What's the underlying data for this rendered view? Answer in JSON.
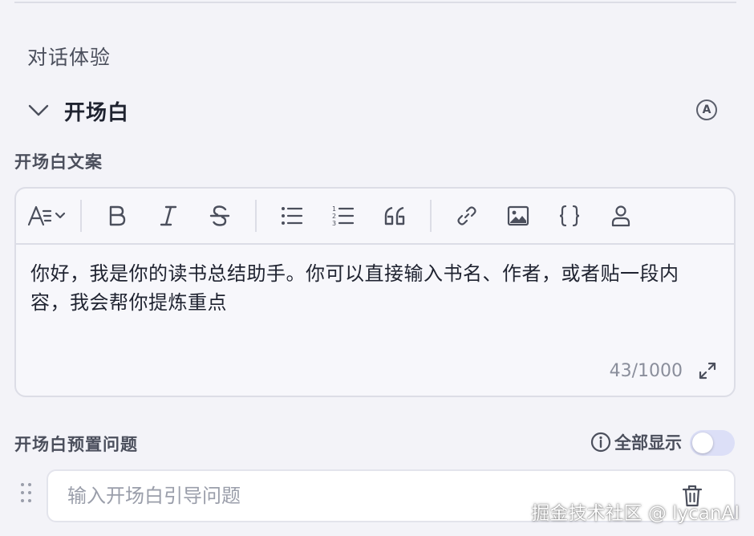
{
  "section": {
    "title": "对话体验"
  },
  "opening": {
    "title": "开场白",
    "auto_badge": "A",
    "text_label": "开场白文案",
    "content": "你好，我是你的读书总结助手。你可以直接输入书名、作者，或者贴一段内容，我会帮你提炼重点",
    "counter": "43/1000",
    "toolbar": [
      "text-style",
      "bold",
      "italic",
      "strikethrough",
      "bullet-list",
      "numbered-list",
      "quote",
      "link",
      "image",
      "code",
      "mention"
    ]
  },
  "preset": {
    "label": "开场白预置问题",
    "show_all": "全部显示",
    "show_all_enabled": false,
    "input_placeholder": "输入开场白引导问题"
  },
  "watermark": "掘金技术社区 @ lycanAI"
}
